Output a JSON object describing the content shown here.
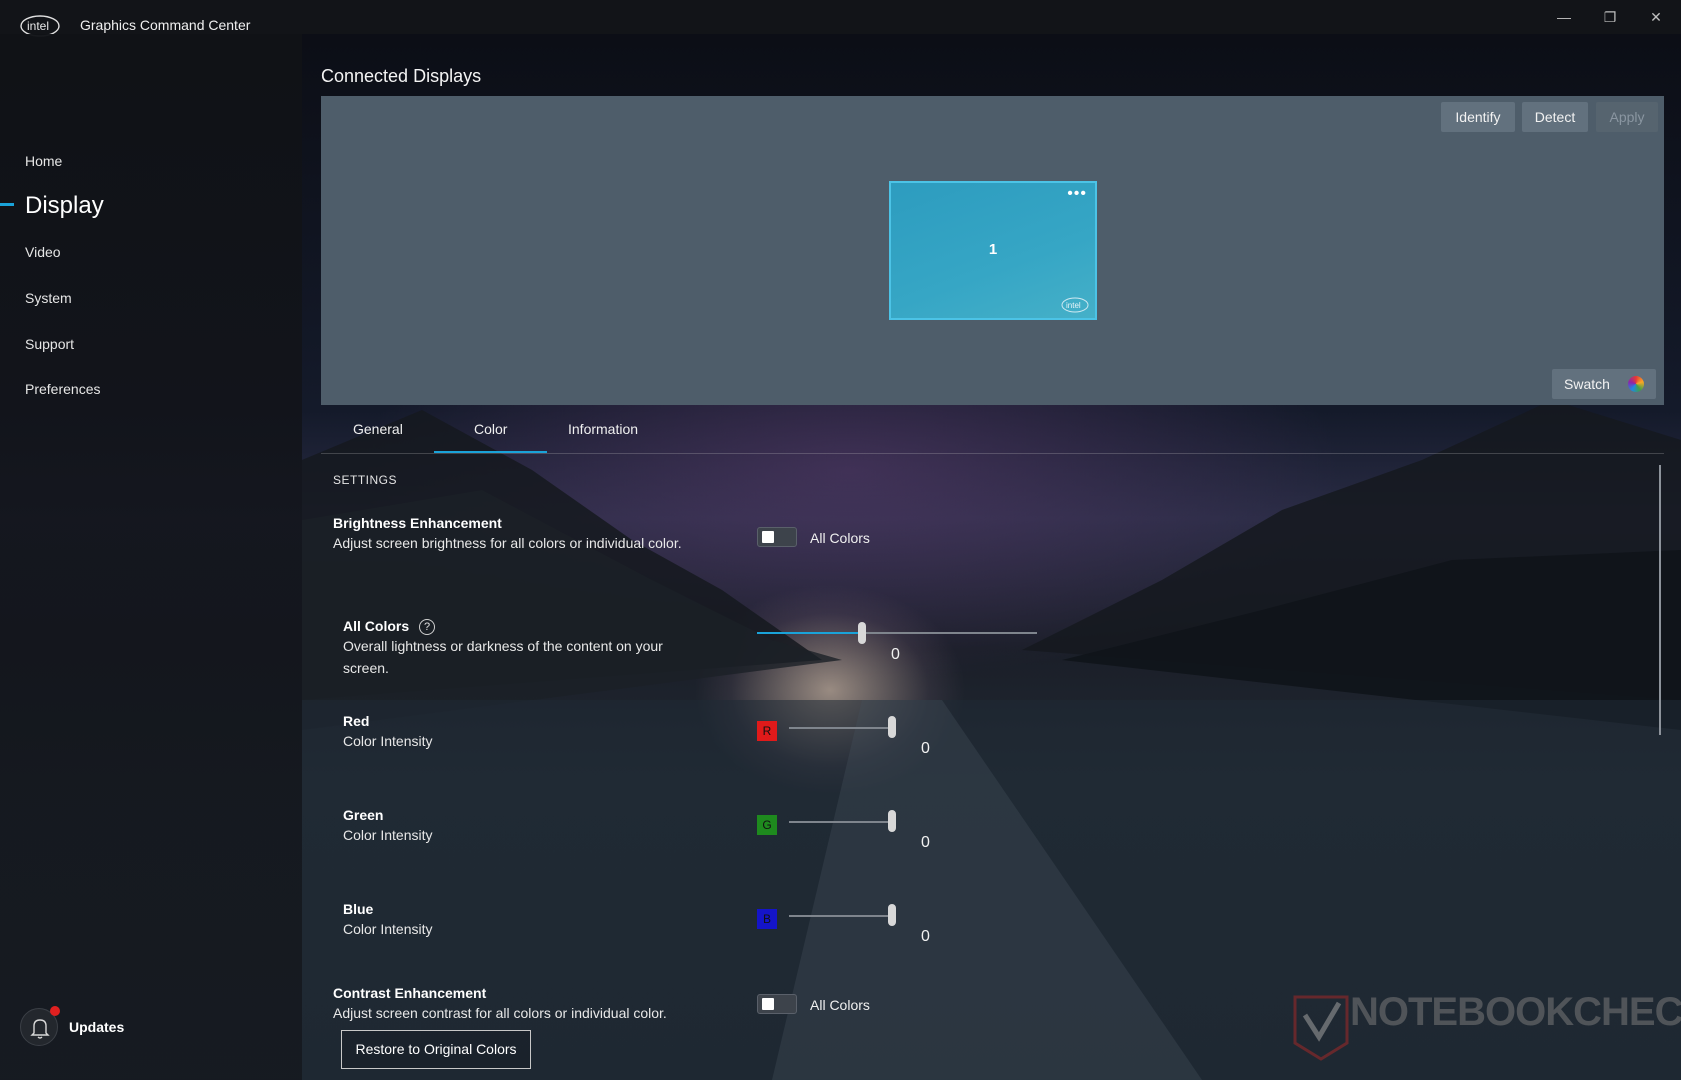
{
  "app": {
    "title": "Graphics Command Center",
    "logo_text": "intel",
    "window_controls": {
      "minimize": "—",
      "restore": "❐",
      "close": "✕"
    }
  },
  "sidebar": {
    "items": [
      {
        "label": "Home"
      },
      {
        "label": "Display",
        "active": true
      },
      {
        "label": "Video"
      },
      {
        "label": "System"
      },
      {
        "label": "Support"
      },
      {
        "label": "Preferences"
      }
    ],
    "updates_label": "Updates",
    "updates_badge": true
  },
  "displays": {
    "section_title": "Connected Displays",
    "identify_label": "Identify",
    "detect_label": "Detect",
    "apply_label": "Apply",
    "monitor_number": "1",
    "monitor_more": "•••",
    "monitor_logo_text": "intel",
    "swatch_label": "Swatch"
  },
  "tabs": [
    {
      "label": "General"
    },
    {
      "label": "Color",
      "active": true
    },
    {
      "label": "Information"
    }
  ],
  "settings": {
    "heading": "SETTINGS",
    "brightness": {
      "title": "Brightness Enhancement",
      "description": "Adjust screen brightness for all colors or individual color.",
      "toggle_label": "All Colors",
      "toggle_on": false
    },
    "all_colors": {
      "title": "All Colors",
      "help": "?",
      "description": "Overall lightness or darkness of the content on your screen.",
      "value": "0",
      "slider_fraction": 0.5
    },
    "red": {
      "title": "Red",
      "description": "Color Intensity",
      "chip": "R",
      "chip_color": "#e01a1a",
      "value": "0",
      "slider_fraction": 1.0
    },
    "green": {
      "title": "Green",
      "description": "Color Intensity",
      "chip": "G",
      "chip_color": "#1e8a1e",
      "value": "0",
      "slider_fraction": 1.0
    },
    "blue": {
      "title": "Blue",
      "description": "Color Intensity",
      "chip": "B",
      "chip_color": "#1414c8",
      "value": "0",
      "slider_fraction": 1.0
    },
    "contrast": {
      "title": "Contrast Enhancement",
      "description": "Adjust screen contrast for all colors or individual color.",
      "toggle_label": "All Colors",
      "toggle_on": false
    },
    "restore_label": "Restore to Original Colors"
  },
  "watermark": "NOTEBOOKCHECK",
  "colors": {
    "accent": "#1aa3d9",
    "panel": "#4e5d6a",
    "monitor": "#36a6c5"
  }
}
